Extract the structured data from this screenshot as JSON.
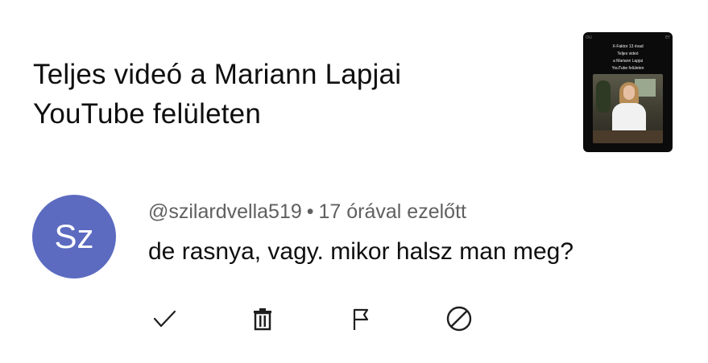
{
  "video": {
    "title_line1": "Teljes videó a Mariann Lapjai",
    "title_line2": "YouTube felületen",
    "thumbnail": {
      "line1": "X-Faktor 13 évad",
      "line2": "Teljes videó",
      "line3": "a Mariann Lapjai",
      "line4": "YouTube felületen"
    }
  },
  "comment": {
    "avatar_initials": "Sz",
    "avatar_color": "#5c6bc0",
    "author": "@szilardvella519",
    "separator": "•",
    "time": "17 órával ezelőtt",
    "text": "de rasnya, vagy. mikor halsz man meg?"
  },
  "actions": [
    {
      "icon": "check-icon"
    },
    {
      "icon": "trash-icon"
    },
    {
      "icon": "flag-icon"
    },
    {
      "icon": "block-icon"
    }
  ]
}
